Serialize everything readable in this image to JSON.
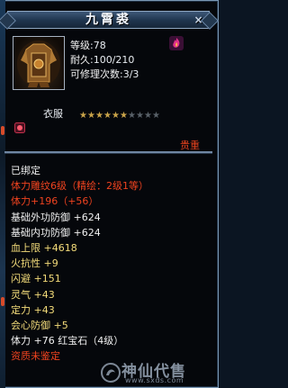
{
  "window": {
    "title": "九霄裘",
    "close_glyph": "×"
  },
  "item": {
    "portrait_icon": "armor-icon",
    "level_label": "等级",
    "level_value": ":78",
    "durability_label": "耐久",
    "durability_value": ":100/210",
    "repair_label": "可修理次数",
    "repair_value": ":3/3",
    "class_icon": "flame-icon",
    "type_label": "衣服",
    "stars_filled": 6,
    "stars_total": 10,
    "badge_icon": "bound-icon",
    "quality": "贵重"
  },
  "attributes": [
    {
      "text": "已绑定",
      "color": "white"
    },
    {
      "text": "体力雕纹6级（精绘：2级1等）",
      "color": "red"
    },
    {
      "text": "体力+196（+56）",
      "color": "red"
    },
    {
      "text": "基础外功防御 +624",
      "color": "white"
    },
    {
      "text": "基础内功防御 +624",
      "color": "white"
    },
    {
      "text": "血上限 +4618",
      "color": "yellow"
    },
    {
      "text": "火抗性 +9",
      "color": "yellow"
    },
    {
      "text": "闪避 +151",
      "color": "yellow"
    },
    {
      "text": "灵气 +43",
      "color": "yellow"
    },
    {
      "text": "定力 +43",
      "color": "yellow"
    },
    {
      "text": "会心防御 +5",
      "color": "yellow"
    },
    {
      "text": "体力 +76 红宝石（4级）",
      "color": "white"
    },
    {
      "text": "资质未鉴定",
      "color": "red"
    }
  ],
  "watermark": {
    "name": "神仙代售",
    "url": "www.sxds.com"
  }
}
